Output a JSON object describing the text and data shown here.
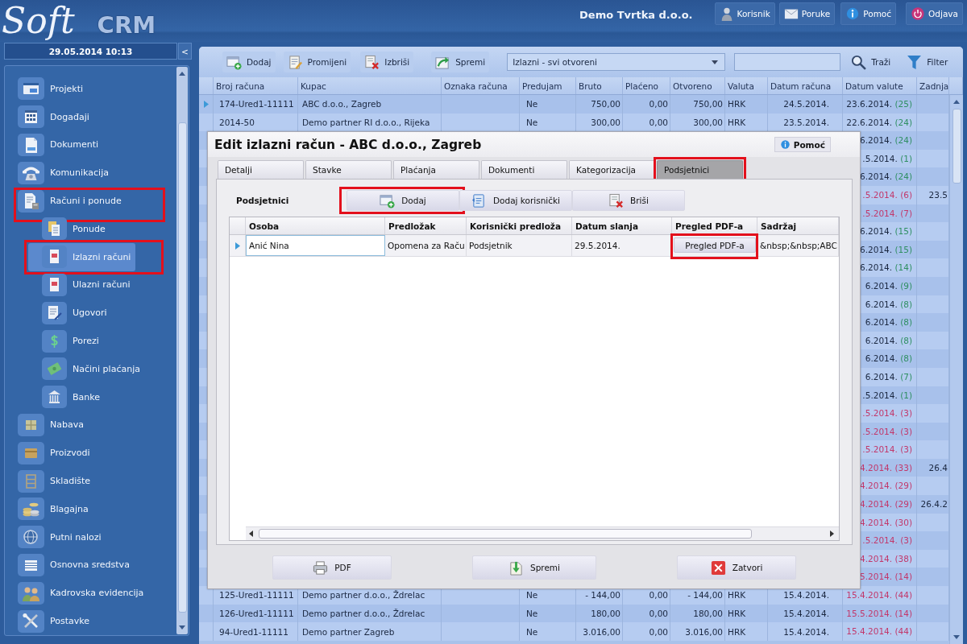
{
  "header": {
    "logo": {
      "script": "Soft",
      "bold": "CRM"
    },
    "company": "Demo Tvrtka d.o.o.",
    "buttons": [
      {
        "label": "Korisnik"
      },
      {
        "label": "Poruke"
      },
      {
        "label": "Pomoć"
      },
      {
        "label": "Odjava"
      }
    ]
  },
  "sidebar": {
    "datetime": "29.05.2014 10:13",
    "collapse_button": "<",
    "items": [
      {
        "label": "Projekti",
        "selected": false,
        "highlighted": false
      },
      {
        "label": "Događaji",
        "selected": false,
        "highlighted": false
      },
      {
        "label": "Dokumenti",
        "selected": false,
        "highlighted": false
      },
      {
        "label": "Komunikacija",
        "selected": false,
        "highlighted": false
      },
      {
        "label": "Računi i ponude",
        "selected": false,
        "highlighted": true,
        "children": [
          {
            "label": "Ponude",
            "selected": false,
            "highlighted": false
          },
          {
            "label": "Izlazni računi",
            "selected": true,
            "highlighted": true
          },
          {
            "label": "Ulazni računi",
            "selected": false,
            "highlighted": false
          },
          {
            "label": "Ugovori",
            "selected": false,
            "highlighted": false
          },
          {
            "label": "Porezi",
            "selected": false,
            "highlighted": false
          },
          {
            "label": "Načini plaćanja",
            "selected": false,
            "highlighted": false
          },
          {
            "label": "Banke",
            "selected": false,
            "highlighted": false
          }
        ]
      },
      {
        "label": "Nabava",
        "selected": false,
        "highlighted": false
      },
      {
        "label": "Proizvodi",
        "selected": false,
        "highlighted": false
      },
      {
        "label": "Skladište",
        "selected": false,
        "highlighted": false
      },
      {
        "label": "Blagajna",
        "selected": false,
        "highlighted": false
      },
      {
        "label": "Putni nalozi",
        "selected": false,
        "highlighted": false
      },
      {
        "label": "Osnovna sredstva",
        "selected": false,
        "highlighted": false
      },
      {
        "label": "Kadrovska evidencija",
        "selected": false,
        "highlighted": false
      },
      {
        "label": "Postavke",
        "selected": false,
        "highlighted": false
      }
    ]
  },
  "toolbar": {
    "buttons": [
      {
        "label": "Dodaj"
      },
      {
        "label": "Promijeni"
      },
      {
        "label": "Izbriši"
      },
      {
        "label": "Spremi"
      }
    ],
    "view_select": {
      "value": "Izlazni - svi otvoreni"
    },
    "search_button": "Traži",
    "filter_button": "Filter"
  },
  "table": {
    "columns": [
      "Broj računa",
      "Kupac",
      "Oznaka računa",
      "Predujam",
      "Bruto",
      "Plaćeno",
      "Otvoreno",
      "Valuta",
      "Datum računa",
      "Datum valute",
      "Zadnja"
    ],
    "rows": [
      {
        "selected": true,
        "broj_racuna": "174-Ured1-11111",
        "kupac": "ABC d.o.o., Zagreb",
        "predujam": "Ne",
        "bruto": "750,00",
        "placeno": "0,00",
        "otvoreno": "750,00",
        "valuta": "HRK",
        "datum_racuna": "24.5.2014.",
        "datum_valute": {
          "date": "23.6.2014.",
          "days": "(25)",
          "overdue": false
        }
      },
      {
        "selected": false,
        "broj_racuna": "2014-50",
        "kupac": "Demo partner RI d.o.o., Rijeka",
        "predujam": "Ne",
        "bruto": "300,00",
        "placeno": "0,00",
        "otvoreno": "300,00",
        "valuta": "HRK",
        "datum_racuna": "23.5.2014.",
        "datum_valute": {
          "date": "22.6.2014.",
          "days": "(24)",
          "overdue": false
        }
      },
      {
        "selected": false,
        "datum_valute": {
          "date": "6.2014.",
          "days": "(24)",
          "overdue": false
        }
      },
      {
        "selected": false,
        "datum_valute": {
          "date": ".5.2014.",
          "days": "(1)",
          "overdue": false
        }
      },
      {
        "selected": false,
        "datum_valute": {
          "date": "6.2014.",
          "days": "(24)",
          "overdue": false
        }
      },
      {
        "selected": false,
        "datum_valute": {
          "date": ".5.2014.",
          "days": "(6)",
          "overdue": true
        },
        "zadnja": "23.5"
      },
      {
        "selected": false,
        "datum_valute": {
          "date": ".5.2014.",
          "days": "(7)",
          "overdue": true
        }
      },
      {
        "selected": false,
        "datum_valute": {
          "date": "6.2014.",
          "days": "(15)",
          "overdue": false
        }
      },
      {
        "selected": false,
        "datum_valute": {
          "date": "6.2014.",
          "days": "(15)",
          "overdue": false
        }
      },
      {
        "selected": false,
        "datum_valute": {
          "date": "6.2014.",
          "days": "(14)",
          "overdue": false
        }
      },
      {
        "selected": false,
        "datum_valute": {
          "date": "6.2014.",
          "days": "(9)",
          "overdue": false
        }
      },
      {
        "selected": false,
        "datum_valute": {
          "date": "6.2014.",
          "days": "(8)",
          "overdue": false
        }
      },
      {
        "selected": false,
        "datum_valute": {
          "date": "6.2014.",
          "days": "(8)",
          "overdue": false
        }
      },
      {
        "selected": false,
        "datum_valute": {
          "date": "6.2014.",
          "days": "(8)",
          "overdue": false
        }
      },
      {
        "selected": false,
        "datum_valute": {
          "date": "6.2014.",
          "days": "(8)",
          "overdue": false
        }
      },
      {
        "selected": false,
        "datum_valute": {
          "date": "6.2014.",
          "days": "(7)",
          "overdue": false
        }
      },
      {
        "selected": false,
        "datum_valute": {
          "date": ".5.2014.",
          "days": "(1)",
          "overdue": false
        }
      },
      {
        "selected": false,
        "datum_valute": {
          "date": ".5.2014.",
          "days": "(3)",
          "overdue": true
        }
      },
      {
        "selected": false,
        "datum_valute": {
          "date": ".5.2014.",
          "days": "(3)",
          "overdue": true
        }
      },
      {
        "selected": false,
        "datum_valute": {
          "date": ".5.2014.",
          "days": "(3)",
          "overdue": true
        }
      },
      {
        "selected": false,
        "datum_valute": {
          "date": "4.2014.",
          "days": "(33)",
          "overdue": true
        },
        "zadnja": "26.4"
      },
      {
        "selected": false,
        "datum_valute": {
          "date": "4.2014.",
          "days": "(29)",
          "overdue": true
        }
      },
      {
        "selected": false,
        "datum_valute": {
          "date": "4.2014.",
          "days": "(29)",
          "overdue": true
        },
        "zadnja": "26.4.2"
      },
      {
        "selected": false,
        "datum_valute": {
          "date": "4.2014.",
          "days": "(30)",
          "overdue": true
        }
      },
      {
        "selected": false,
        "datum_valute": {
          "date": ".5.2014.",
          "days": "(3)",
          "overdue": true
        }
      },
      {
        "selected": false,
        "datum_valute": {
          "date": "4.2014.",
          "days": "(38)",
          "overdue": true
        }
      },
      {
        "selected": false,
        "datum_valute": {
          "date": "5.2014.",
          "days": "(14)",
          "overdue": true
        }
      },
      {
        "selected": false,
        "broj_racuna": "125-Ured1-11111",
        "kupac": "Demo partner d.o.o., Ždrelac",
        "predujam": "Ne",
        "bruto": "- 144,00",
        "placeno": "0,00",
        "otvoreno": "- 144,00",
        "valuta": "HRK",
        "datum_racuna": "15.4.2014.",
        "datum_valute": {
          "date": "15.4.2014.",
          "days": "(44)",
          "overdue": true
        }
      },
      {
        "selected": false,
        "broj_racuna": "126-Ured1-11111",
        "kupac": "Demo partner d.o.o., Ždrelac",
        "predujam": "Ne",
        "bruto": "180,00",
        "placeno": "0,00",
        "otvoreno": "180,00",
        "valuta": "HRK",
        "datum_racuna": "15.4.2014.",
        "datum_valute": {
          "date": "15.5.2014.",
          "days": "(14)",
          "overdue": true
        }
      },
      {
        "selected": false,
        "broj_racuna": "94-Ured1-11111",
        "kupac": "Demo partner Zagreb",
        "predujam": "Ne",
        "bruto": "3.016,00",
        "placeno": "0,00",
        "otvoreno": "3.016,00",
        "valuta": "HRK",
        "datum_racuna": "15.4.2014.",
        "datum_valute": {
          "date": "15.4.2014.",
          "days": "(44)",
          "overdue": true
        }
      }
    ]
  },
  "dialog": {
    "title": "Edit izlazni račun - ABC d.o.o., Zagreb",
    "help_button": "Pomoć",
    "tabs": [
      {
        "label": "Detalji",
        "selected": false,
        "highlighted": false
      },
      {
        "label": "Stavke",
        "selected": false,
        "highlighted": false
      },
      {
        "label": "Plaćanja",
        "selected": false,
        "highlighted": false
      },
      {
        "label": "Dokumenti",
        "selected": false,
        "highlighted": false
      },
      {
        "label": "Kategorizacija",
        "selected": false,
        "highlighted": false
      },
      {
        "label": "Podsjetnici",
        "selected": true,
        "highlighted": true
      }
    ],
    "section_label": "Podsjetnici",
    "actions": [
      {
        "label": "Dodaj",
        "highlighted": true
      },
      {
        "label": "Dodaj korisnički",
        "highlighted": false
      },
      {
        "label": "Briši",
        "highlighted": false
      }
    ],
    "grid": {
      "columns": [
        "Osoba",
        "Predložak",
        "Korisnički predloža",
        "Datum slanja",
        "Pregled PDF-a",
        "Sadržaj"
      ],
      "rows": [
        {
          "selected": true,
          "osoba": "Anić Nina",
          "predlozak": "Opomena za Raču",
          "korisnicki_predlozak": "Podsjetnik",
          "datum_slanja": "29.5.2014.",
          "pdf_button": {
            "label": "Pregled PDF-a",
            "highlighted": true
          },
          "sadrzaj": "&nbsp;&nbsp;ABC"
        }
      ]
    },
    "footer_buttons": [
      {
        "label": "PDF"
      },
      {
        "label": "Spremi"
      },
      {
        "label": "Zatvori"
      }
    ]
  }
}
